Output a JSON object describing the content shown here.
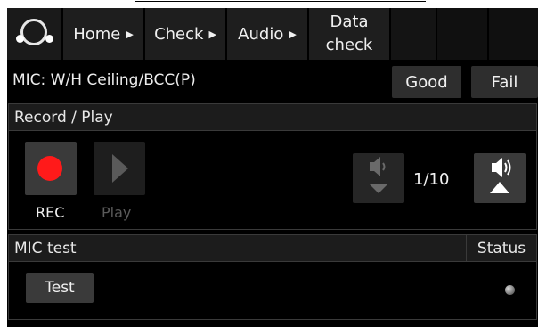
{
  "nav": {
    "logo_icon": "circle-logo-icon",
    "items": [
      {
        "label": "Home",
        "icon": "chevron-right-icon"
      },
      {
        "label": "Check",
        "icon": "chevron-right-icon"
      },
      {
        "label": "Audio",
        "icon": "chevron-right-icon"
      },
      {
        "label_line1": "Data",
        "label_line2": "check"
      }
    ]
  },
  "mic": {
    "label": "MIC: W/H Ceiling/BCC(P)",
    "good_label": "Good",
    "fail_label": "Fail"
  },
  "record": {
    "header": "Record / Play",
    "rec_label": "REC",
    "play_label": "Play",
    "rec_icon": "record-dot-icon",
    "play_icon": "play-icon",
    "volume_down_icon": "volume-down-icon",
    "volume_up_icon": "volume-up-icon",
    "volume_level": "1/10"
  },
  "mictest": {
    "header": "MIC test",
    "status_header": "Status",
    "test_label": "Test",
    "status_icon": "status-led-icon"
  },
  "colors": {
    "background": "#000000",
    "button": "#3a3a3a",
    "record": "#ff1a1a"
  }
}
